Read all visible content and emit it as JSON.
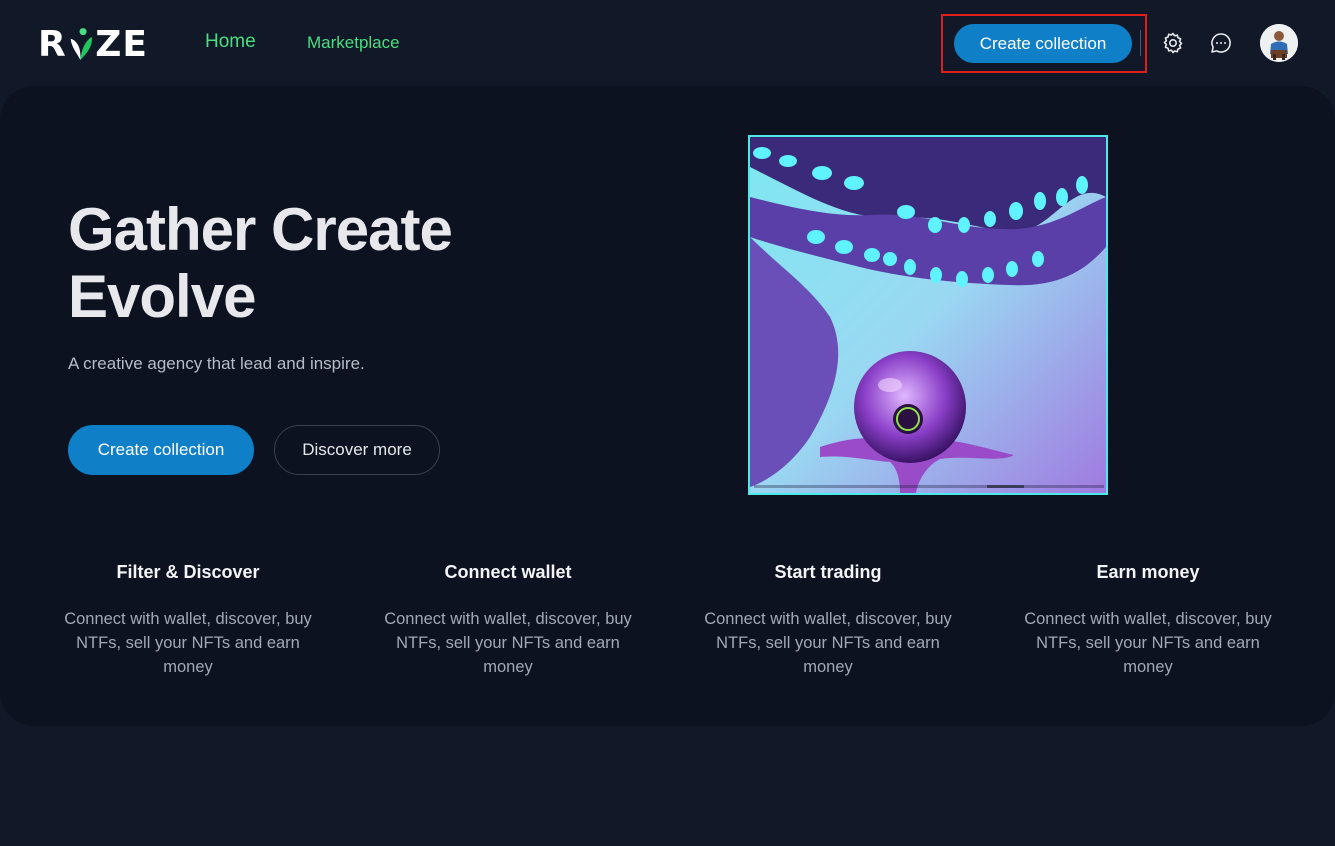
{
  "header": {
    "logo": "RIZE",
    "nav": [
      {
        "label": "Home"
      },
      {
        "label": "Marketplace"
      }
    ],
    "create_label": "Create collection"
  },
  "hero": {
    "title_line1": "Gather Create",
    "title_line2": "Evolve",
    "subtitle": "A creative agency that lead and inspire.",
    "primary_label": "Create collection",
    "secondary_label": "Discover more"
  },
  "features": [
    {
      "title": "Filter & Discover",
      "text": "Connect with wallet, discover, buy NTFs, sell your NFTs and earn money"
    },
    {
      "title": "Connect wallet",
      "text": "Connect with wallet, discover, buy NTFs, sell your NFTs and earn money"
    },
    {
      "title": "Start trading",
      "text": "Connect with wallet, discover, buy NTFs, sell your NFTs and earn money"
    },
    {
      "title": "Earn money",
      "text": "Connect with wallet, discover, buy NTFs, sell your NFTs and earn money"
    }
  ],
  "icons": {
    "settings": "gear-icon",
    "messages": "chat-icon",
    "avatar": "user-avatar"
  },
  "colors": {
    "background": "#111827",
    "card": "#0c1220",
    "accent": "#0f7fc7",
    "nav": "#4ade80",
    "highlight": "#e11d1d"
  }
}
